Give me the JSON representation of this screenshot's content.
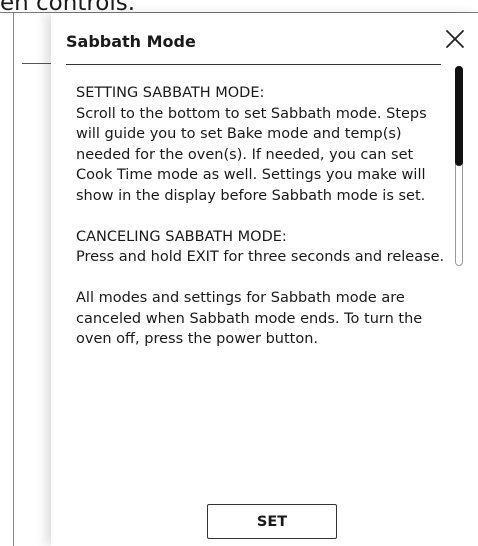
{
  "background": {
    "heading_fragment": "en controls."
  },
  "modal": {
    "title": "Sabbath Mode",
    "close_icon": "close-icon",
    "paragraphs": [
      "SETTING SABBATH MODE:",
      "Scroll to the bottom to set Sabbath mode. Steps will guide you to set Bake mode and temp(s) needed for the oven(s). If needed, you can set Cook Time mode as well. Settings you make will show in the display before Sabbath mode is set.",
      "CANCELING SABBATH MODE:",
      "Press and hold EXIT for three seconds and release.",
      "All modes and settings for Sabbath mode are canceled when Sabbath mode ends. To turn the oven off, press the power button."
    ],
    "set_label": "SET"
  },
  "colors": {
    "text": "#1a1a1a",
    "scroll_thumb": "#111111",
    "background": "#ffffff"
  }
}
